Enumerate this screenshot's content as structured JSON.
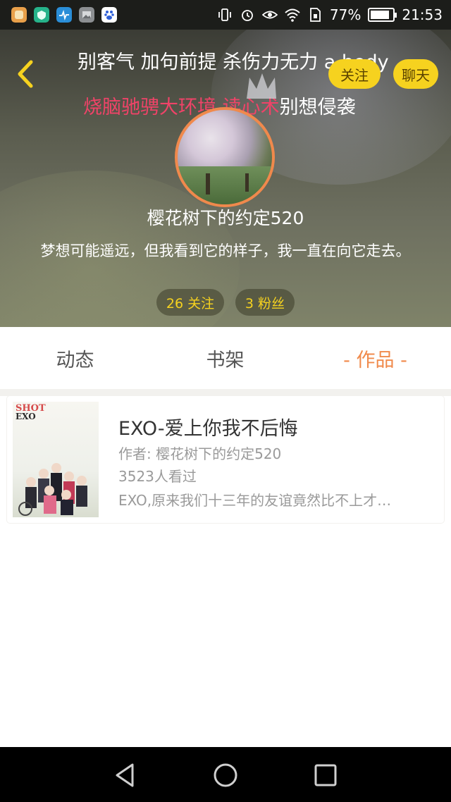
{
  "status_bar": {
    "battery": "77%",
    "time": "21:53",
    "app_icons": [
      "app-store-icon",
      "wifi-shield-icon",
      "health-icon",
      "gallery-icon",
      "baidu-paw-icon"
    ],
    "status_icons": [
      "vibrate-icon",
      "alarm-icon",
      "eye-icon",
      "wifi-icon",
      "sim-icon"
    ]
  },
  "header": {
    "marquee_line1": "别客气 加句前提 杀伤力无力 a body",
    "marquee_line2_pink": "烧脑驰骋大环境 读心术",
    "marquee_line2_rest": "别想侵袭",
    "follow_label": "关注",
    "chat_label": "聊天",
    "username": "樱花树下的约定520",
    "bio": "梦想可能遥远，但我看到它的样子，我一直在向它走去。",
    "following": "26 关注",
    "fans": "3 粉丝"
  },
  "tabs": [
    {
      "label": "动态"
    },
    {
      "label": "书架"
    },
    {
      "label": "- 作品 -"
    }
  ],
  "works": [
    {
      "title": "EXO-爱上你我不后悔",
      "author": "作者: 樱花树下的约定520",
      "views": "3523人看过",
      "desc": "EXO,原来我们十三年的友谊竟然比不上才…",
      "cover_text_1": "SHOT",
      "cover_text_2": "EXO"
    }
  ],
  "colors": {
    "accent_orange": "#f08a4b",
    "button_yellow": "#f6d21f",
    "pink_text": "#f04368"
  }
}
